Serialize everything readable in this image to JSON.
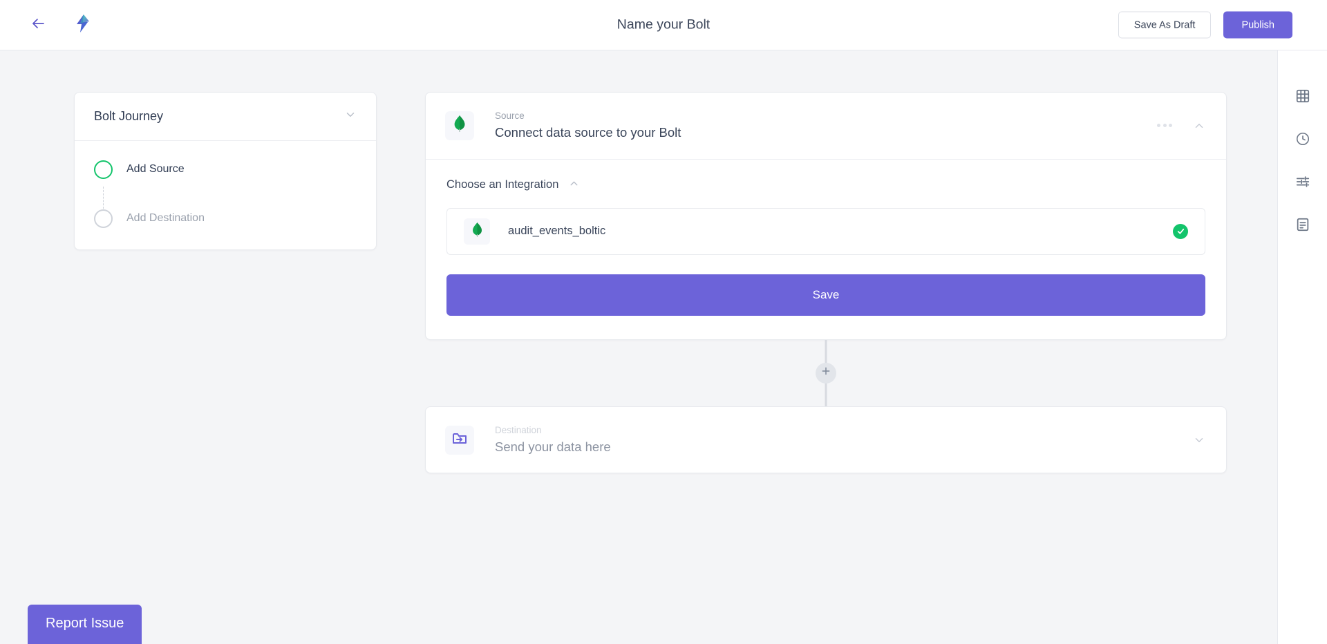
{
  "header": {
    "title": "Name your Bolt",
    "back_icon": "arrow-left-icon",
    "logo_icon": "bolt-logo-icon",
    "save_draft_label": "Save As Draft",
    "publish_label": "Publish"
  },
  "right_rail": {
    "items": [
      {
        "icon": "grid-icon",
        "name": "table-view"
      },
      {
        "icon": "clock-icon",
        "name": "history"
      },
      {
        "icon": "sliders-icon",
        "name": "settings"
      },
      {
        "icon": "document-icon",
        "name": "logs"
      }
    ]
  },
  "journey": {
    "title": "Bolt Journey",
    "collapse_icon": "chevron-down-icon",
    "steps": [
      {
        "label": "Add Source",
        "state": "active"
      },
      {
        "label": "Add Destination",
        "state": "pending"
      }
    ]
  },
  "source_card": {
    "kicker": "Source",
    "title": "Connect data source to your Bolt",
    "icon": "mongodb-leaf-icon",
    "menu_icon": "more-options-icon",
    "collapse_icon": "chevron-up-icon",
    "section": {
      "title": "Choose an Integration",
      "collapse_icon": "chevron-up-icon"
    },
    "integration": {
      "name": "audit_events_boltic",
      "icon": "mongodb-leaf-icon",
      "status_icon": "check-circle-icon",
      "selected": true
    },
    "save_label": "Save"
  },
  "connector": {
    "add_icon": "plus-icon"
  },
  "destination_card": {
    "kicker": "Destination",
    "title": "Send your data here",
    "icon": "folder-arrow-icon",
    "collapse_icon": "chevron-down-icon"
  },
  "footer": {
    "report_issue_label": "Report Issue"
  },
  "colors": {
    "accent": "#6c63d9",
    "success": "#13c46b",
    "canvas_bg": "#f4f5f7",
    "text_primary": "#394459",
    "text_muted": "#9aa1ad"
  }
}
